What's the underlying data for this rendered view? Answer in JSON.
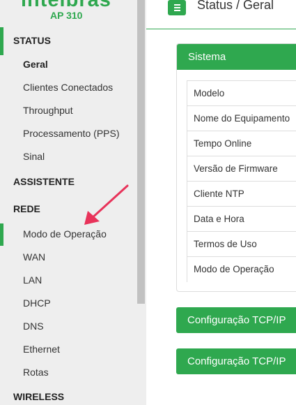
{
  "brand": {
    "logo_text": "intelbras",
    "model": "AP 310",
    "accent": "#2fa84f"
  },
  "header": {
    "title": "Status / Geral",
    "menu_icon": "hamburger-icon"
  },
  "sidebar": {
    "sections": [
      {
        "label": "STATUS",
        "items": [
          "Geral",
          "Clientes Conectados",
          "Throughput",
          "Processamento (PPS)",
          "Sinal"
        ]
      },
      {
        "label": "ASSISTENTE",
        "items": []
      },
      {
        "label": "REDE",
        "items": [
          "Modo de Operação",
          "WAN",
          "LAN",
          "DHCP",
          "DNS",
          "Ethernet",
          "Rotas"
        ]
      },
      {
        "label": "WIRELESS",
        "items": []
      }
    ],
    "active_item": "Geral",
    "highlighted_item": "Modo de Operação"
  },
  "sistema": {
    "title": "Sistema",
    "rows": [
      "Modelo",
      "Nome do Equipamento",
      "Tempo Online",
      "Versão de Firmware",
      "Cliente NTP",
      "Data e Hora",
      "Termos de Uso",
      "Modo de Operação"
    ]
  },
  "panels": [
    {
      "title": "Configuração TCP/IP"
    },
    {
      "title": "Configuração TCP/IP"
    }
  ],
  "annotation": {
    "arrow_color": "#e8335a"
  }
}
